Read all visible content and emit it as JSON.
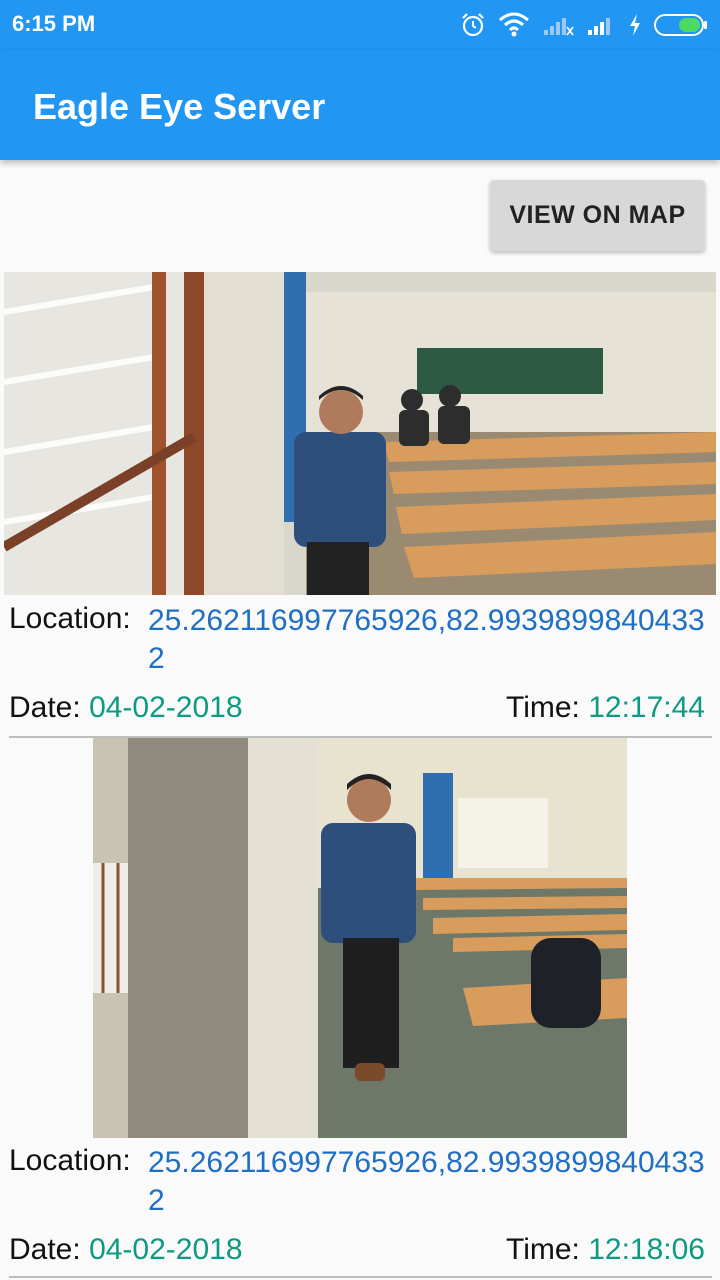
{
  "status_bar": {
    "time": "6:15 PM",
    "icons": [
      "alarm-icon",
      "wifi-icon",
      "signal-icon",
      "signal-icon",
      "charging-icon",
      "battery-icon"
    ]
  },
  "app_bar": {
    "title": "Eagle Eye Server"
  },
  "view_map_button": {
    "label": "VIEW ON MAP"
  },
  "records": [
    {
      "location_label": "Location:",
      "location_value": "25.262116997765926,82.99398998404332",
      "date_label": "Date:",
      "date_value": "04-02-2018",
      "time_label": "Time:",
      "time_value": "12:17:44"
    },
    {
      "location_label": "Location:",
      "location_value": "25.262116997765926,82.99398998404332",
      "date_label": "Date:",
      "date_value": "04-02-2018",
      "time_label": "Time:",
      "time_value": "12:18:06"
    }
  ],
  "colors": {
    "primary": "#2196f3",
    "location_text": "#1e6fc5",
    "date_time_text": "#0c9a82",
    "battery_green": "#4cd964"
  }
}
